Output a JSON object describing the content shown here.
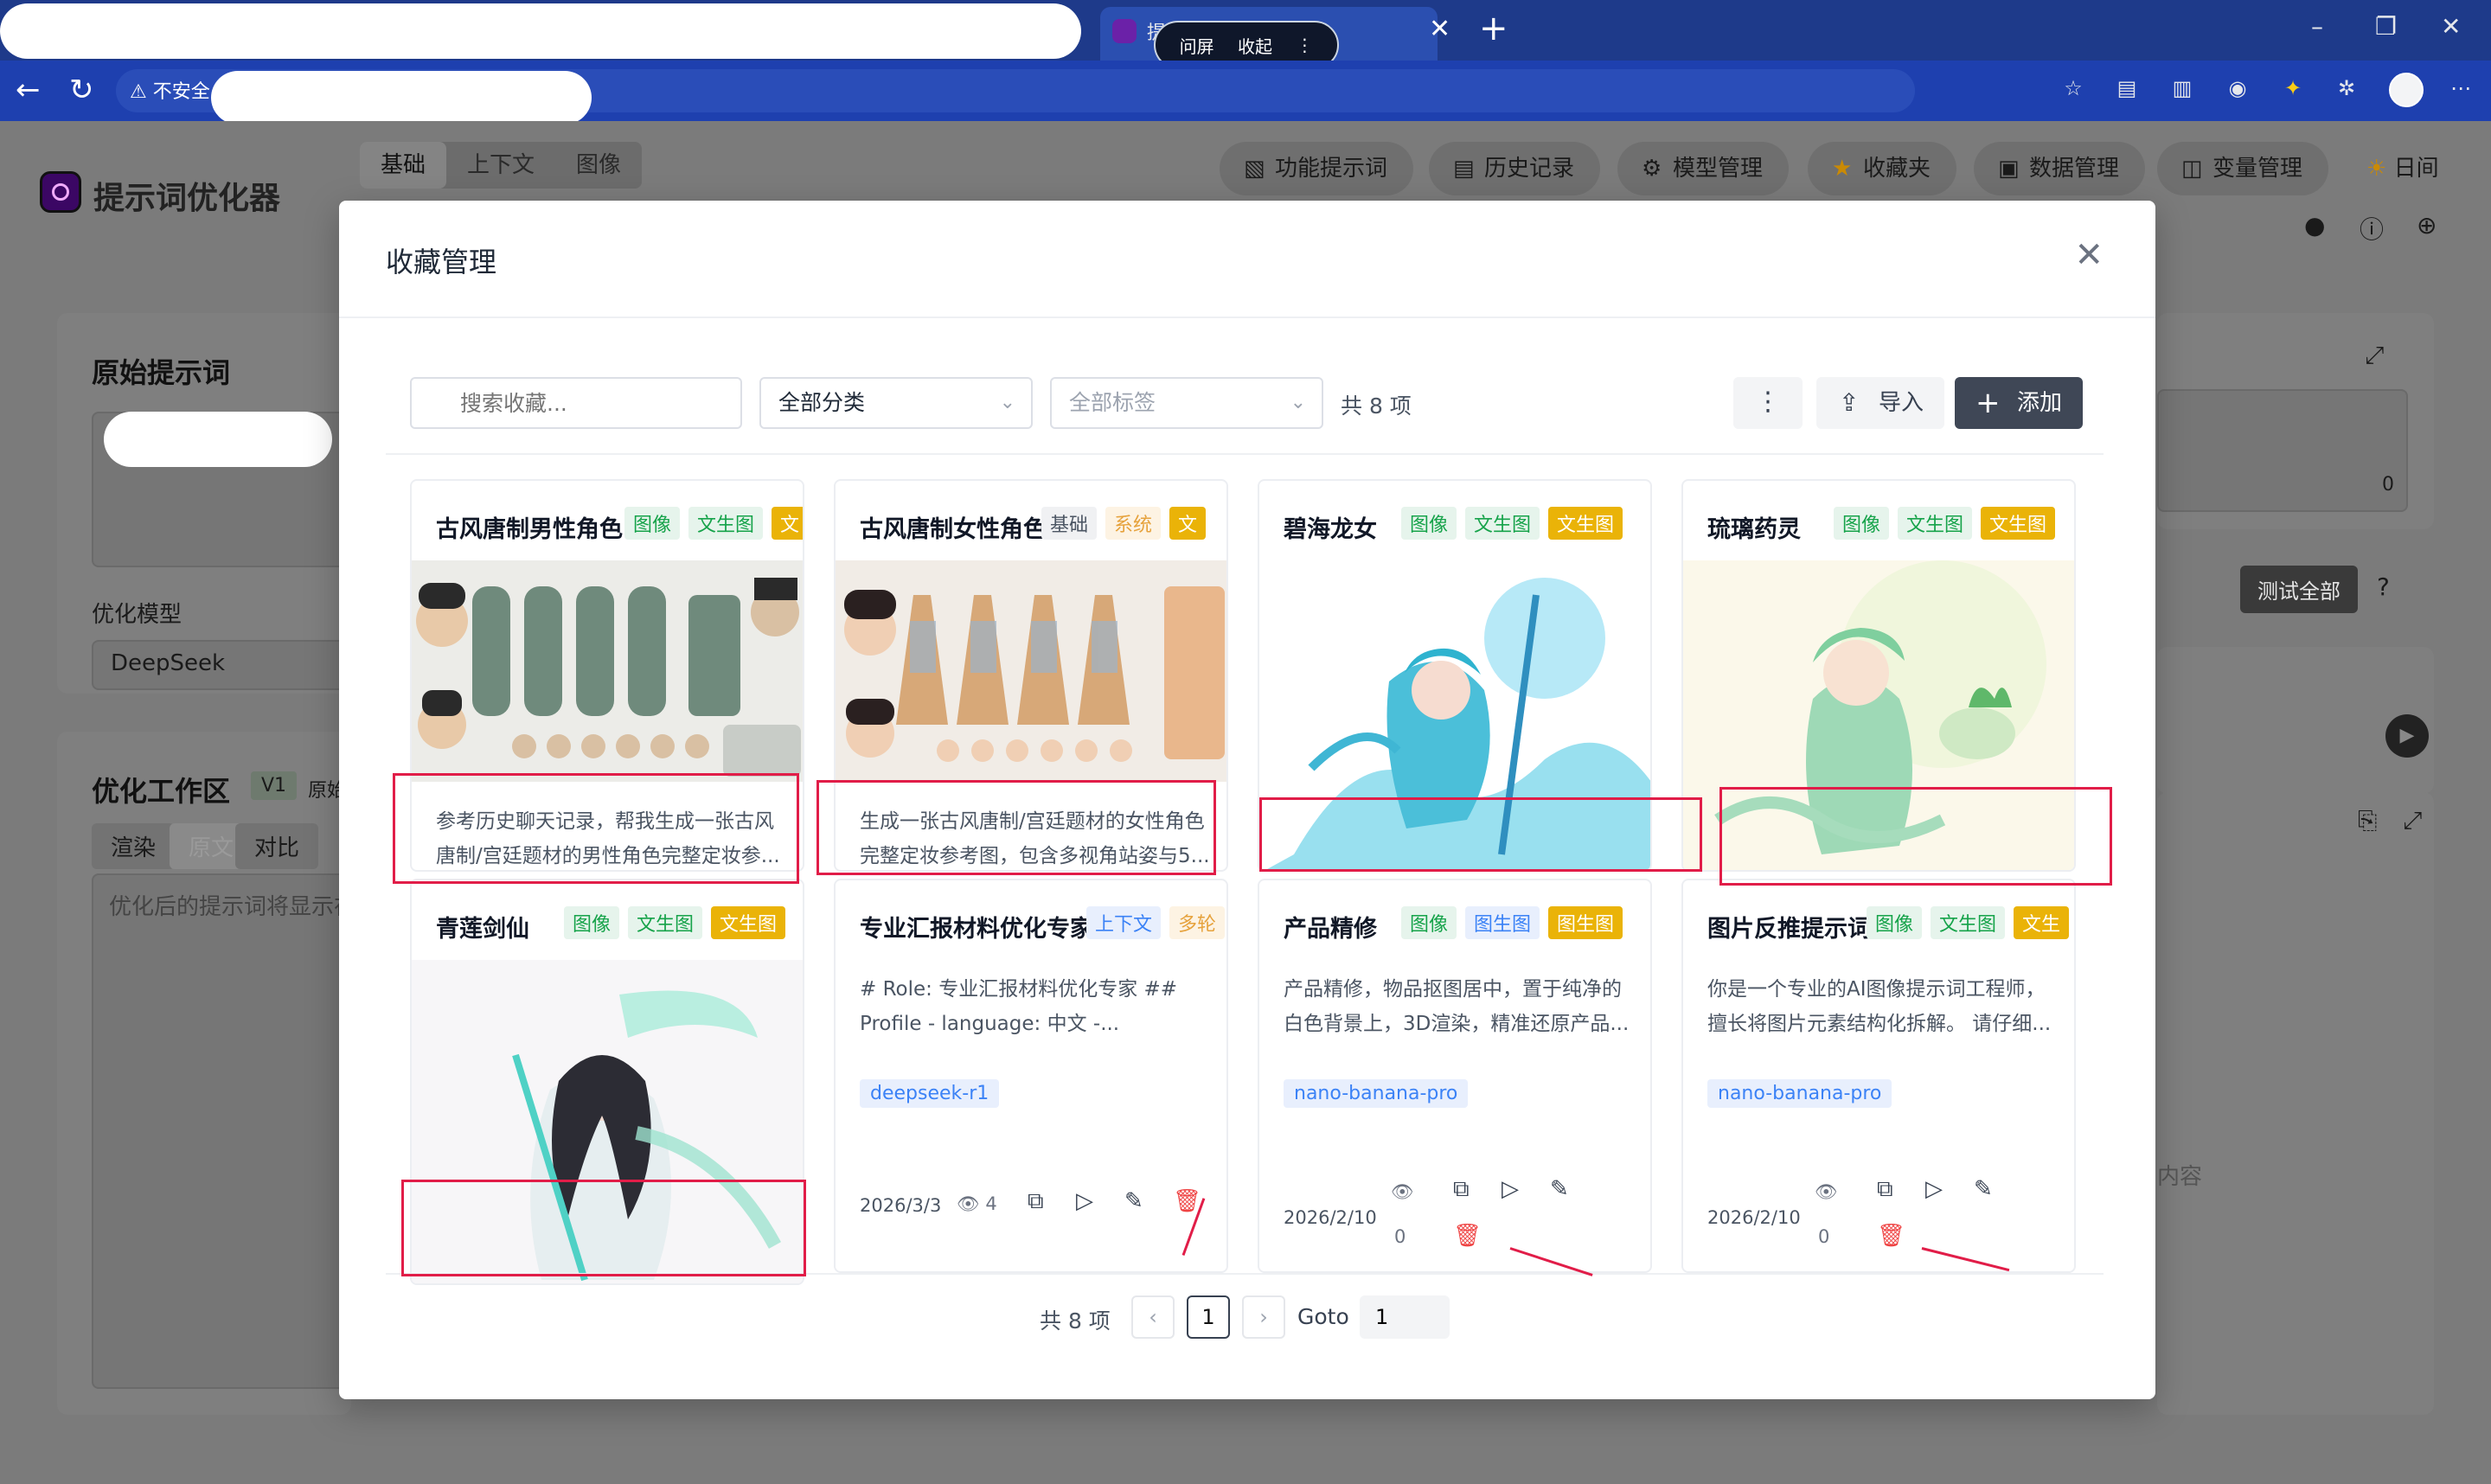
{
  "browser": {
    "tab_title": "提示词优化器",
    "pill_left": "问屏",
    "pill_right": "收起",
    "security": "不安全"
  },
  "app": {
    "title": "提示词优化器",
    "mode_tabs": [
      "基础",
      "上下文",
      "图像"
    ],
    "top_buttons": [
      {
        "label": "功能提示词",
        "icon": "document-icon"
      },
      {
        "label": "历史记录",
        "icon": "scroll-icon"
      },
      {
        "label": "模型管理",
        "icon": "gear-icon"
      },
      {
        "label": "收藏夹",
        "icon": "star-icon"
      },
      {
        "label": "数据管理",
        "icon": "save-icon"
      },
      {
        "label": "变量管理",
        "icon": "variable-icon"
      }
    ],
    "theme_label": "日间",
    "original_prompt_heading": "原始提示词",
    "model_label": "优化模型",
    "model_value": "DeepSeek",
    "workspace_heading": "优化工作区",
    "workspace_version": "V1",
    "workspace_extra": "原始",
    "workspace_tabs": [
      "渲染",
      "原文",
      "对比"
    ],
    "workspace_placeholder": "优化后的提示词将显示在",
    "test_all": "测试全部",
    "counter": "0",
    "empty_text": "内容"
  },
  "modal": {
    "title": "收藏管理",
    "search_placeholder": "搜索收藏...",
    "category_select": "全部分类",
    "tag_select": "全部标签",
    "total": "共 8 项",
    "import_label": "导入",
    "add_label": "添加",
    "cards": [
      {
        "title": "古风唐制男性角色",
        "tags": [
          {
            "text": "图像",
            "style": "green"
          },
          {
            "text": "文生图",
            "style": "green"
          },
          {
            "text": "文",
            "style": "yellow"
          }
        ],
        "image": "male-costume-sheet",
        "description": "参考历史聊天记录，帮我生成一张古风唐制/宫廷题材的男性角色完整定妆参..."
      },
      {
        "title": "古风唐制女性角色",
        "tags": [
          {
            "text": "基础",
            "style": "gray"
          },
          {
            "text": "系统",
            "style": "orange"
          },
          {
            "text": "文",
            "style": "yellow"
          }
        ],
        "image": "female-costume-sheet",
        "description": "生成一张古风唐制/宫廷题材的女性角色完整定妆参考图，包含多视角站姿与5..."
      },
      {
        "title": "碧海龙女",
        "tags": [
          {
            "text": "图像",
            "style": "green"
          },
          {
            "text": "文生图",
            "style": "green"
          },
          {
            "text": "文生图",
            "style": "yellow"
          }
        ],
        "image": "sea-dragon-girl"
      },
      {
        "title": "琉璃药灵",
        "tags": [
          {
            "text": "图像",
            "style": "green"
          },
          {
            "text": "文生图",
            "style": "green"
          },
          {
            "text": "文生图",
            "style": "yellow"
          }
        ],
        "image": "glass-herb-spirit"
      },
      {
        "title": "青莲剑仙",
        "tags": [
          {
            "text": "图像",
            "style": "green"
          },
          {
            "text": "文生图",
            "style": "green"
          },
          {
            "text": "文生图",
            "style": "yellow"
          }
        ],
        "image": "lotus-sword-immortal"
      },
      {
        "title": "专业汇报材料优化专家",
        "tags": [
          {
            "text": "上下文",
            "style": "blue"
          },
          {
            "text": "多轮",
            "style": "orange"
          }
        ],
        "description": "# Role: 专业汇报材料优化专家 ## Profile - language: 中文 -...",
        "chip": "deepseek-r1",
        "date": "2026/3/3",
        "views": "4"
      },
      {
        "title": "产品精修",
        "tags": [
          {
            "text": "图像",
            "style": "green"
          },
          {
            "text": "图生图",
            "style": "blue"
          },
          {
            "text": "图生图",
            "style": "yellow"
          }
        ],
        "description": "产品精修，物品抠图居中，置于纯净的白色背景上，3D渲染，精准还原产品...",
        "chip": "nano-banana-pro",
        "date": "2026/2/10",
        "views": "0"
      },
      {
        "title": "图片反推提示词",
        "tags": [
          {
            "text": "图像",
            "style": "green"
          },
          {
            "text": "文生图",
            "style": "green"
          },
          {
            "text": "文生",
            "style": "yellow"
          }
        ],
        "description": "你是一个专业的AI图像提示词工程师，擅长将图片元素结构化拆解。 请仔细...",
        "chip": "nano-banana-pro",
        "date": "2026/2/10",
        "views": "0"
      }
    ],
    "pagination": {
      "total": "共 8 项",
      "current": "1",
      "goto_label": "Goto",
      "goto_value": "1"
    }
  },
  "colors": {
    "accent_dark": "#3f4756",
    "tag_green": "#16a34a",
    "tag_yellow": "#eab308",
    "annotation_red": "#e11d48"
  }
}
